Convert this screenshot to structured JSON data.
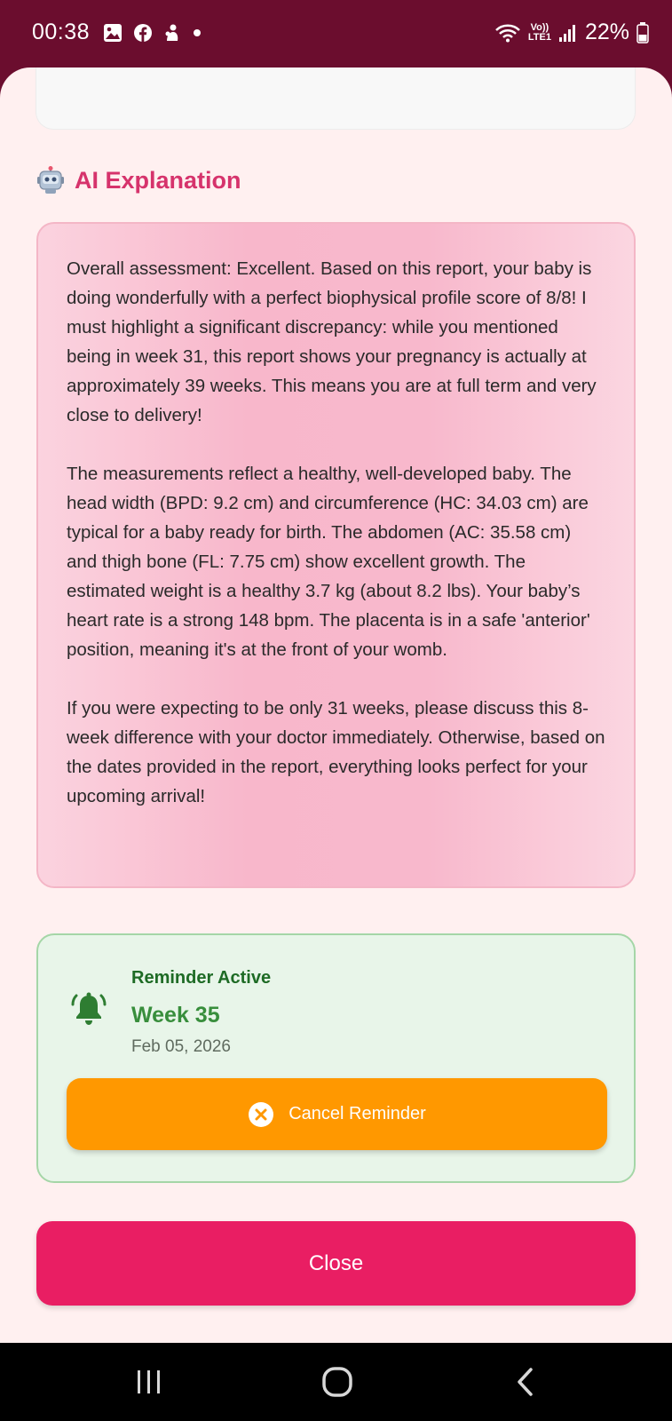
{
  "status_bar": {
    "time": "00:38",
    "left_icons": [
      "gallery-icon",
      "facebook-icon",
      "notification-icon",
      "dot-icon"
    ],
    "lte_label": "Vo))\nLTE1",
    "battery_percent": "22%"
  },
  "section": {
    "icon": "robot-icon",
    "title": "AI Explanation"
  },
  "explanation": {
    "paragraphs": [
      "Overall assessment: Excellent. Based on this report, your baby is doing wonderfully with a perfect biophysical profile score of 8/8! I must highlight a significant discrepancy: while you mentioned being in week 31, this report shows your pregnancy is actually at approximately 39 weeks. This means you are at full term and very close to delivery!",
      "The measurements reflect a healthy, well-developed baby. The head width (BPD: 9.2 cm) and circumference (HC: 34.03 cm) are typical for a baby ready for birth. The abdomen (AC: 35.58 cm) and thigh bone (FL: 7.75 cm) show excellent growth. The estimated weight is a healthy 3.7 kg (about 8.2 lbs). Your baby’s heart rate is a strong 148 bpm. The placenta is in a safe 'anterior' position, meaning it's at the front of your womb.",
      "If you were expecting to be only 31 weeks, please discuss this 8-week difference with your doctor immediately. Otherwise, based on the dates provided in the report, everything looks perfect for your upcoming arrival!"
    ]
  },
  "reminder": {
    "status": "Reminder Active",
    "week": "Week 35",
    "date": "Feb 05, 2026",
    "cancel_label": "Cancel Reminder"
  },
  "close_label": "Close",
  "colors": {
    "status_bar": "#6b0d2e",
    "accent_pink": "#e91e63",
    "title_pink": "#d6336c",
    "reminder_green": "#388e3c",
    "cancel_orange": "#ff9800"
  },
  "nav_bar": {
    "items": [
      "recent-apps-icon",
      "home-icon",
      "back-icon"
    ]
  }
}
